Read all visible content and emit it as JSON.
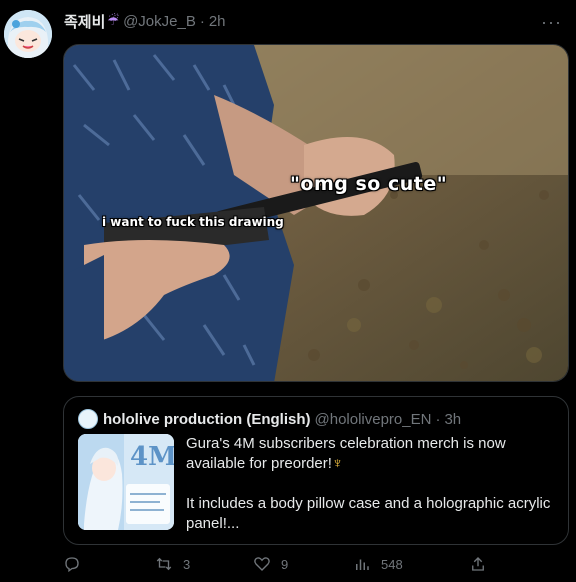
{
  "tweet": {
    "display_name": "족제비",
    "name_emoji": "☔",
    "handle": "@JokJe_B",
    "separator": "·",
    "time": "2h",
    "more_label": "···"
  },
  "media": {
    "caption_top": "\"omg so cute\"",
    "caption_left": "i want to fuck this drawing"
  },
  "quote": {
    "display_name": "hololive production (English)",
    "handle": "@hololivepro_EN",
    "separator": "·",
    "time": "3h",
    "text_line1": "Gura's 4M subscribers celebration merch is now available for preorder!",
    "emoji": "♆",
    "text_line2": "It includes a body pillow case and a holographic acrylic panel!...",
    "thumb_title": "4M"
  },
  "actions": {
    "reply_count": "",
    "retweet_count": "3",
    "like_count": "9",
    "views_count": "548"
  },
  "colors": {
    "background": "#000000",
    "text": "#e7e9ea",
    "muted": "#71767b",
    "border": "#2f3336"
  }
}
